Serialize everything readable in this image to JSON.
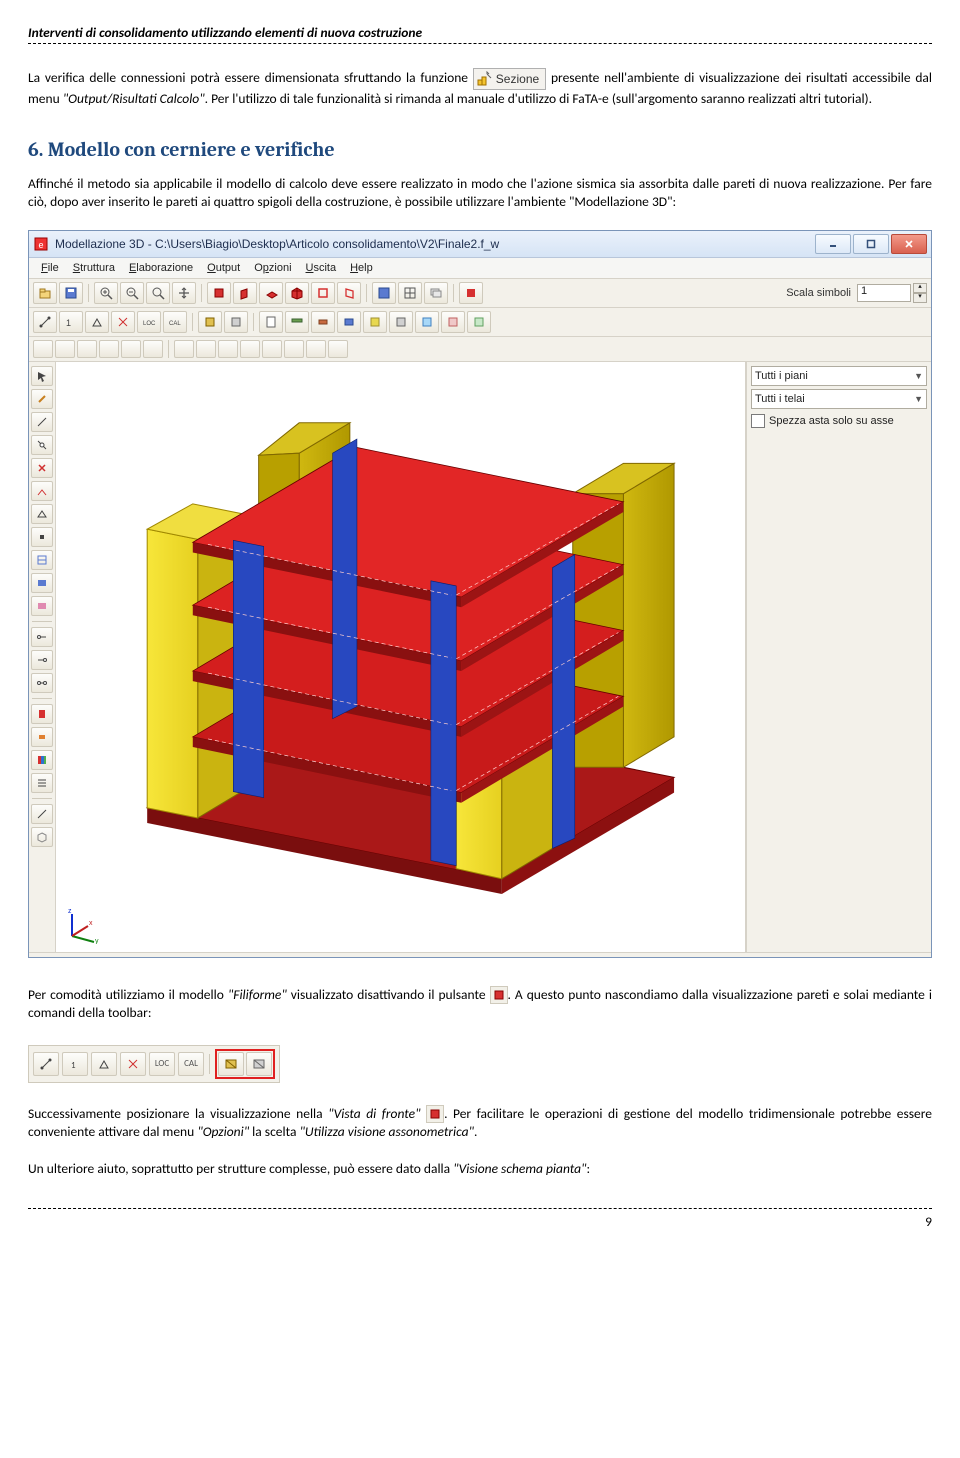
{
  "header": {
    "title": "Interventi di consolidamento utilizzando elementi di nuova costruzione"
  },
  "intro": {
    "p1a": "La verifica delle connessioni potrà essere dimensionata sfruttando la funzione ",
    "sezione_label": "Sezione",
    "p1b": " presente nell'ambiente di visualizzazione dei risultati accessibile dal menu ",
    "p1c_it": "\"Output/Risultati Calcolo\"",
    "p1d": ". Per l'utilizzo di tale funzionalità si rimanda al manuale d'utilizzo di FaTA-e (sull'argomento saranno realizzati altri tutorial)."
  },
  "section6": {
    "title": "6. Modello con cerniere e verifiche",
    "p1": "Affinché il metodo sia applicabile il modello di calcolo deve essere realizzato in modo che l'azione sismica sia assorbita dalle pareti di nuova realizzazione. Per fare ciò, dopo aver inserito le pareti ai quattro spigoli della costruzione, è possibile utilizzare l'ambiente \"Modellazione 3D\":"
  },
  "app": {
    "title": "Modellazione 3D - C:\\Users\\Biagio\\Desktop\\Articolo consolidamento\\V2\\Finale2.f_w",
    "menus": [
      "File",
      "Struttura",
      "Elaborazione",
      "Output",
      "Opzioni",
      "Uscita",
      "Help"
    ],
    "scala_label": "Scala simboli",
    "scala_value": "1",
    "right": {
      "combo1": "Tutti i piani",
      "combo2": "Tutti i telai",
      "check1": "Spezza asta solo su asse"
    }
  },
  "after_screenshot": {
    "p1a": "Per comodità utilizziamo il modello ",
    "p1a_it": "\"Filiforme\"",
    "p1b": " visualizzato disattivando il pulsante ",
    "p1c": ". A questo punto nascondiamo dalla visualizzazione pareti e solai mediante i comandi della toolbar:"
  },
  "final_paragraphs": {
    "p2a": "Successivamente posizionare la visualizzazione nella ",
    "p2a_it": "\"Vista di fronte\"",
    "p2b": ". Per facilitare le operazioni di gestione del modello tridimensionale potrebbe essere conveniente attivare dal menu ",
    "p2b_it": "\"Opzioni\"",
    "p2c": " la scelta ",
    "p2c_it": "\"Utilizza visione assonometrica\"",
    "p2d": ".",
    "p3a": "Un ulteriore aiuto, soprattutto per strutture complesse, può essere dato dalla ",
    "p3a_it": "\"Visione schema pianta\"",
    "p3b": ":"
  },
  "page_number": "9"
}
